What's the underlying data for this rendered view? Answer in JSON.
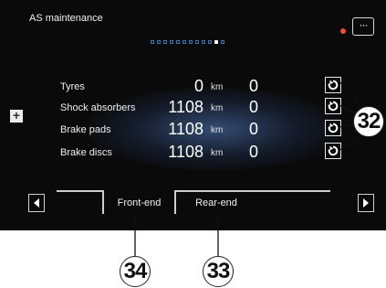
{
  "screen": {
    "title": "AS maintenance",
    "menu_label": "···",
    "pager": {
      "total": 12,
      "active_index": 10
    },
    "plus_label": "+"
  },
  "rows": [
    {
      "label": "Tyres",
      "value": "0",
      "unit": "km",
      "count": "0"
    },
    {
      "label": "Shock absorbers",
      "value": "1108",
      "unit": "km",
      "count": "0"
    },
    {
      "label": "Brake pads",
      "value": "1108",
      "unit": "km",
      "count": "0"
    },
    {
      "label": "Brake discs",
      "value": "1108",
      "unit": "km",
      "count": "0"
    }
  ],
  "tabs": [
    {
      "label": "Front-end",
      "active": true
    },
    {
      "label": "Rear-end",
      "active": false
    }
  ],
  "callouts": {
    "reset": "32",
    "front_tab": "34",
    "rear_tab": "33"
  },
  "colors": {
    "accent_red": "#e84b3c",
    "pager_blue": "#3c76b4",
    "screen_bg": "#0a0a0a"
  },
  "icons": {
    "reset": "reset-icon",
    "prev": "chevron-left-icon",
    "next": "chevron-right-icon",
    "menu": "more-icon"
  }
}
